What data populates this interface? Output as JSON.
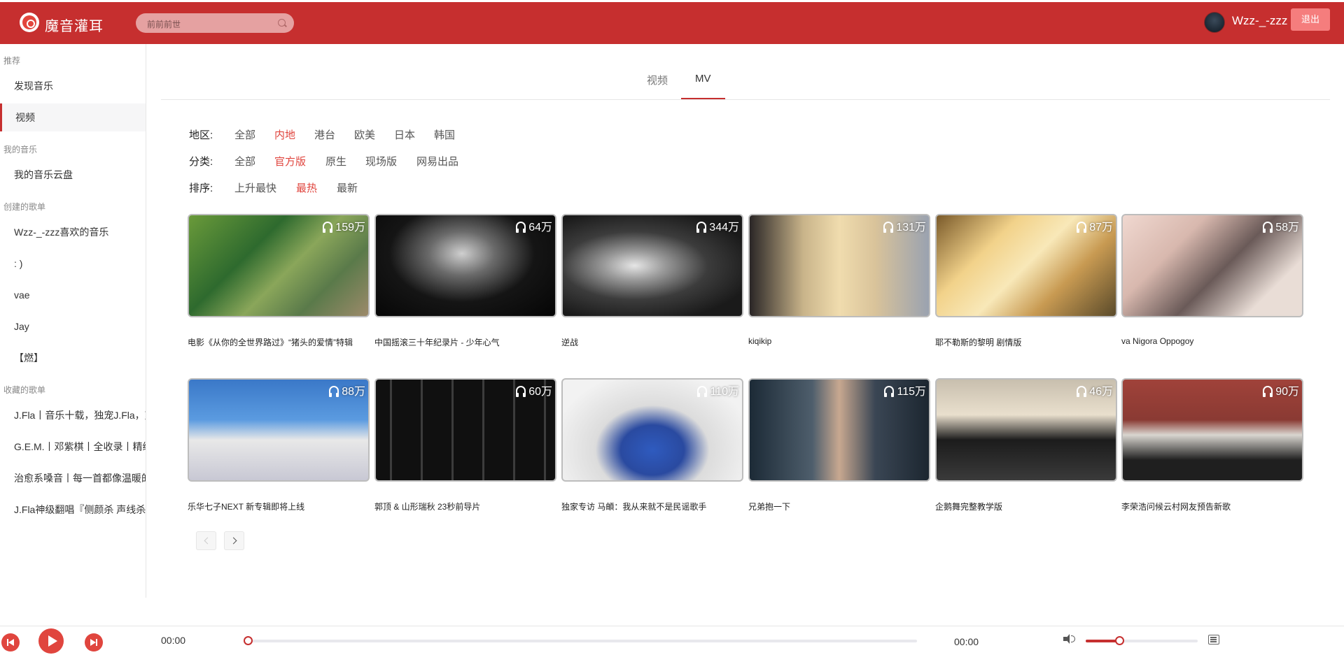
{
  "header": {
    "app_name": "魔音灌耳",
    "search_placeholder": "前前前世",
    "username": "Wzz-_-zzz",
    "logout_label": "退出",
    "brand_color": "#c62f2f"
  },
  "sidebar": {
    "sections": [
      {
        "title": "推荐",
        "items": [
          "发现音乐",
          "视频"
        ]
      },
      {
        "title": "我的音乐",
        "items": [
          "我的音乐云盘"
        ]
      },
      {
        "title": "创建的歌单",
        "items": [
          "Wzz-_-zzz喜欢的音乐",
          ": )",
          "vae",
          "Jay",
          "【燃】"
        ]
      },
      {
        "title": "收藏的歌单",
        "items": [
          "J.Fla丨音乐十载，独宠J.Fla，爽",
          "G.E.M.丨邓紫棋丨全收录丨精编",
          "治愈系嗓音丨每一首都像温暖的",
          "J.Fla神级翻唱『侧颜杀 声线杀』"
        ]
      }
    ],
    "active_item": "视频"
  },
  "tabs": [
    {
      "label": "视频",
      "active": false
    },
    {
      "label": "MV",
      "active": true
    }
  ],
  "filters": {
    "area": {
      "label": "地区:",
      "options": [
        "全部",
        "内地",
        "港台",
        "欧美",
        "日本",
        "韩国"
      ],
      "selected": "内地"
    },
    "type": {
      "label": "分类:",
      "options": [
        "全部",
        "官方版",
        "原生",
        "现场版",
        "网易出品"
      ],
      "selected": "官方版"
    },
    "order": {
      "label": "排序:",
      "options": [
        "上升最快",
        "最热",
        "最新"
      ],
      "selected": "最热"
    }
  },
  "mv_list": [
    {
      "title": "电影《从你的全世界路过》“猪头的爱情”特辑",
      "plays": "159万"
    },
    {
      "title": "中国摇滚三十年纪录片 - 少年心气",
      "plays": "64万"
    },
    {
      "title": "逆战",
      "plays": "344万"
    },
    {
      "title": "kiqikip",
      "plays": "131万"
    },
    {
      "title": "耶不勒斯的黎明 剧情版",
      "plays": "87万"
    },
    {
      "title": "va Nigora Oppogoy",
      "plays": "58万"
    },
    {
      "title": "乐华七子NEXT 新专辑即将上线",
      "plays": "88万"
    },
    {
      "title": "郭顶 & 山形瑞秋 23秒前导片",
      "plays": "60万"
    },
    {
      "title": "独家专访 马頔：我从来就不是民谣歌手",
      "plays": "110万"
    },
    {
      "title": "兄弟抱一下",
      "plays": "115万"
    },
    {
      "title": "企鹅舞完整教学版",
      "plays": "46万"
    },
    {
      "title": "李荣浩问候云村网友预告新歌",
      "plays": "90万"
    }
  ],
  "player": {
    "current_time": "00:00",
    "total_time": "00:00",
    "progress": 0,
    "volume": 0.3
  }
}
